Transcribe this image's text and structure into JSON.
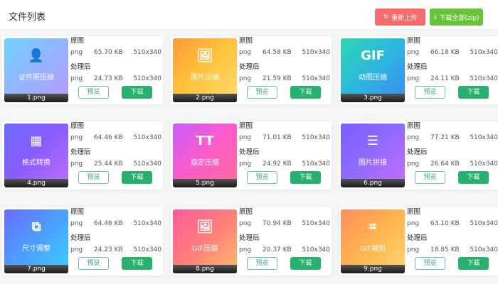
{
  "header": {
    "title": "文件列表",
    "reupload_label": "重新上传",
    "download_all_label": "下载全部(zip)",
    "reupload_color": "#f56c6c",
    "download_all_color": "#67c23a"
  },
  "labels": {
    "original": "原图",
    "processed": "处理后",
    "preview": "预览",
    "download": "下载"
  },
  "files": [
    {
      "name": "1.png",
      "thumb_text": "证件照压缩",
      "thumb_icon": "id-photo-icon",
      "orig_fmt": "png",
      "orig_size": "65.70 KB",
      "orig_dim": "510x340",
      "proc_fmt": "png",
      "proc_size": "24.73 KB",
      "proc_dim": "510x340"
    },
    {
      "name": "2.png",
      "thumb_text": "图片压缩",
      "thumb_icon": "image-icon",
      "orig_fmt": "png",
      "orig_size": "64.58 KB",
      "orig_dim": "510x340",
      "proc_fmt": "png",
      "proc_size": "21.59 KB",
      "proc_dim": "510x340"
    },
    {
      "name": "3.png",
      "thumb_text": "动图压缩",
      "thumb_icon": "gif-icon",
      "orig_fmt": "png",
      "orig_size": "66.18 KB",
      "orig_dim": "510x340",
      "proc_fmt": "png",
      "proc_size": "24.11 KB",
      "proc_dim": "510x340"
    },
    {
      "name": "4.png",
      "thumb_text": "格式转换",
      "thumb_icon": "checker-icon",
      "orig_fmt": "png",
      "orig_size": "64.46 KB",
      "orig_dim": "510x340",
      "proc_fmt": "png",
      "proc_size": "25.44 KB",
      "proc_dim": "510x340"
    },
    {
      "name": "5.png",
      "thumb_text": "指定压缩",
      "thumb_icon": "text-size-icon",
      "orig_fmt": "png",
      "orig_size": "71.01 KB",
      "orig_dim": "510x340",
      "proc_fmt": "png",
      "proc_size": "24.92 KB",
      "proc_dim": "510x340"
    },
    {
      "name": "6.png",
      "thumb_text": "图片拼接",
      "thumb_icon": "stack-icon",
      "orig_fmt": "png",
      "orig_size": "77.21 KB",
      "orig_dim": "510x340",
      "proc_fmt": "png",
      "proc_size": "26.64 KB",
      "proc_dim": "510x340"
    },
    {
      "name": "7.png",
      "thumb_text": "尺寸调整",
      "thumb_icon": "resize-icon",
      "orig_fmt": "png",
      "orig_size": "64.46 KB",
      "orig_dim": "510x340",
      "proc_fmt": "png",
      "proc_size": "24.23 KB",
      "proc_dim": "510x340"
    },
    {
      "name": "8.png",
      "thumb_text": "GIF压缩",
      "thumb_icon": "image-icon",
      "orig_fmt": "png",
      "orig_size": "70.94 KB",
      "orig_dim": "510x340",
      "proc_fmt": "png",
      "proc_size": "20.37 KB",
      "proc_dim": "510x340"
    },
    {
      "name": "9.png",
      "thumb_text": "GIF裁剪",
      "thumb_icon": "crop-icon",
      "orig_fmt": "png",
      "orig_size": "63.10 KB",
      "orig_dim": "510x340",
      "proc_fmt": "png",
      "proc_size": "18.85 KB",
      "proc_dim": "510x340"
    }
  ]
}
